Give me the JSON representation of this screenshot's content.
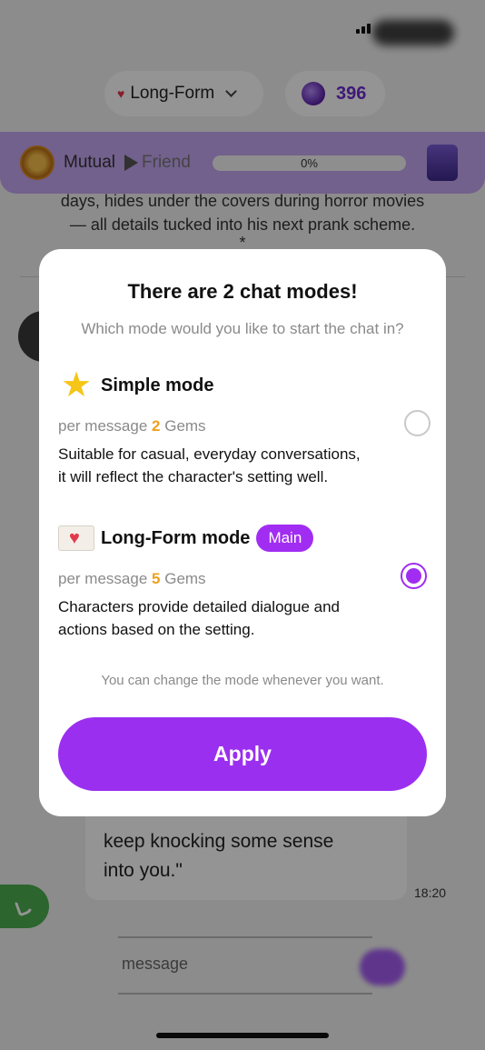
{
  "header": {
    "mode_selector": {
      "label": "Long-Form",
      "icon": "heart-envelope-icon"
    },
    "gems": {
      "count": "396",
      "icon": "gem-icon"
    }
  },
  "relationship": {
    "from": "Mutual",
    "to": "Friend",
    "progress_label": "0%",
    "progress_value": 0
  },
  "chat": {
    "story_line1": "days, hides under the covers during horror movies",
    "story_line2": "— all details tucked into his next prank scheme.",
    "story_line3": "*",
    "bubble_line1": "keep knocking some sense",
    "bubble_line2": "into you.\"",
    "time": "18:20",
    "input_placeholder": "message"
  },
  "dialog": {
    "title": "There are 2 chat modes!",
    "subtitle": "Which mode would you like to start the chat in?",
    "modes": [
      {
        "icon": "star-icon",
        "name": "Simple mode",
        "price_prefix": "per message",
        "price_value": "2",
        "price_unit": "Gems",
        "description_line1": "Suitable for casual, everyday conversations,",
        "description_line2": "it will reflect the character's setting well.",
        "selected": false
      },
      {
        "icon": "heart-envelope-icon",
        "name": "Long-Form mode",
        "badge": "Main",
        "price_prefix": "per message",
        "price_value": "5",
        "price_unit": "Gems",
        "description_line1": "Characters provide detailed dialogue and",
        "description_line2": "actions based on the setting.",
        "selected": true
      }
    ],
    "note": "You can change the mode whenever you want.",
    "apply_label": "Apply"
  },
  "colors": {
    "accent": "#a12df2",
    "gem_highlight": "#f0a020",
    "relationship_bar": "#c4a6f3",
    "call_button": "#4caf50"
  }
}
